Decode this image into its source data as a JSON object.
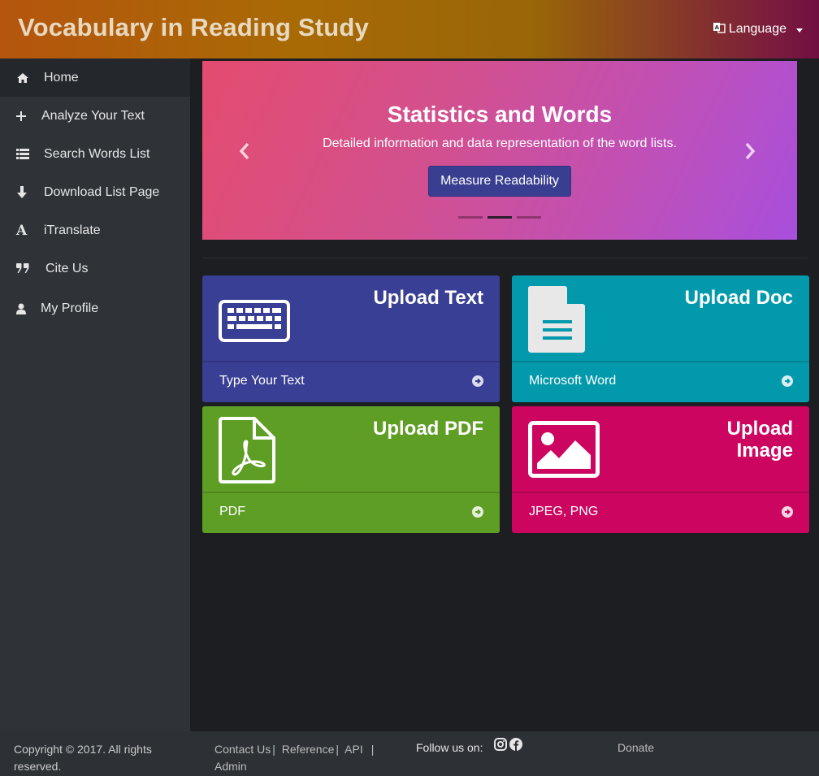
{
  "header": {
    "title": "Vocabulary in Reading Study",
    "language_label": "Language"
  },
  "sidebar": {
    "items": [
      {
        "label": "Home",
        "icon": "home-icon"
      },
      {
        "label": "Analyze Your Text",
        "icon": "plus-icon"
      },
      {
        "label": "Search Words List",
        "icon": "list-icon"
      },
      {
        "label": "Download List Page",
        "icon": "arrow-down-icon"
      },
      {
        "label": "iTranslate",
        "icon": "font-icon"
      },
      {
        "label": "Cite Us",
        "icon": "quote-icon"
      },
      {
        "label": "My Profile",
        "icon": "user-icon"
      }
    ]
  },
  "carousel": {
    "title": "Statistics and Words",
    "subtitle": "Detailed information and data representation of the word lists.",
    "button_label": "Measure Readability",
    "active_indicator": 2,
    "indicator_count": 3
  },
  "cards": [
    {
      "title": "Upload Text",
      "footer": "Type Your Text",
      "color": "#393f94",
      "icon": "keyboard-icon"
    },
    {
      "title": "Upload Doc",
      "footer": "Microsoft Word",
      "color": "#0399ac",
      "icon": "document-icon"
    },
    {
      "title": "Upload PDF",
      "footer": "PDF",
      "color": "#5f9e25",
      "icon": "pdf-file-icon"
    },
    {
      "title_line1": "Upload",
      "title_line2": "Image",
      "footer": "JPEG, PNG",
      "color": "#cc0660",
      "icon": "image-icon"
    }
  ],
  "footer": {
    "copyright_line1": "Copyright © 2017. All rights",
    "copyright_line2": "reserved.",
    "links": [
      "Contact Us",
      "Reference",
      "API",
      "Admin"
    ],
    "follow_label": "Follow us on:",
    "donate_label": "Donate"
  }
}
